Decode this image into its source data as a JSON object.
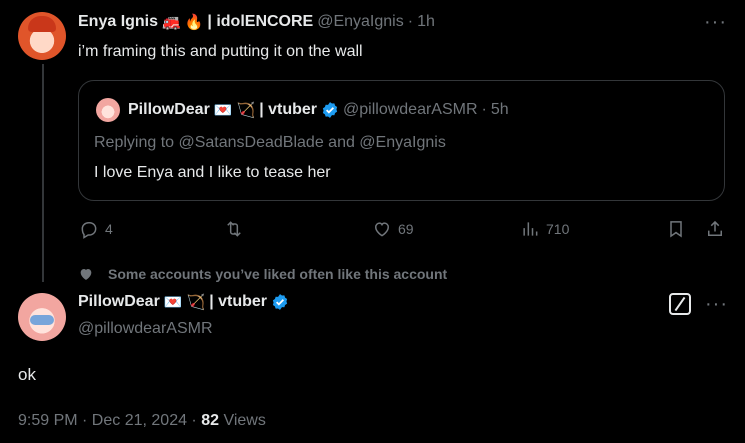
{
  "parent": {
    "display_name": "Enya Ignis",
    "name_suffix": "| idolENCORE",
    "emojis": [
      "🚒",
      "🔥"
    ],
    "handle": "@EnyaIgnis",
    "time": "1h",
    "text": "i’m framing this and putting it on the wall"
  },
  "quote": {
    "display_name": "PillowDear",
    "emojis": [
      "💌",
      "🏹"
    ],
    "name_suffix": "| vtuber",
    "handle": "@pillowdearASMR",
    "time": "5h",
    "replying": "Replying to @SatansDeadBlade and @EnyaIgnis",
    "text": "I love Enya and I like to tease her"
  },
  "actions": {
    "replies": "4",
    "likes": "69",
    "views": "710"
  },
  "social_context": "Some accounts you’ve liked often like this account",
  "main": {
    "display_name": "PillowDear",
    "emojis": [
      "💌",
      "🏹"
    ],
    "name_suffix": "| vtuber",
    "handle": "@pillowdearASMR",
    "text": "ok",
    "timestamp": "9:59 PM · Dec 21, 2024 ·",
    "views_count": "82",
    "views_label": "Views"
  },
  "colors": {
    "background": "#000000",
    "text": "#e7e9ea",
    "secondary": "#71767b",
    "verified": "#1d9bf0",
    "border": "#333639"
  }
}
